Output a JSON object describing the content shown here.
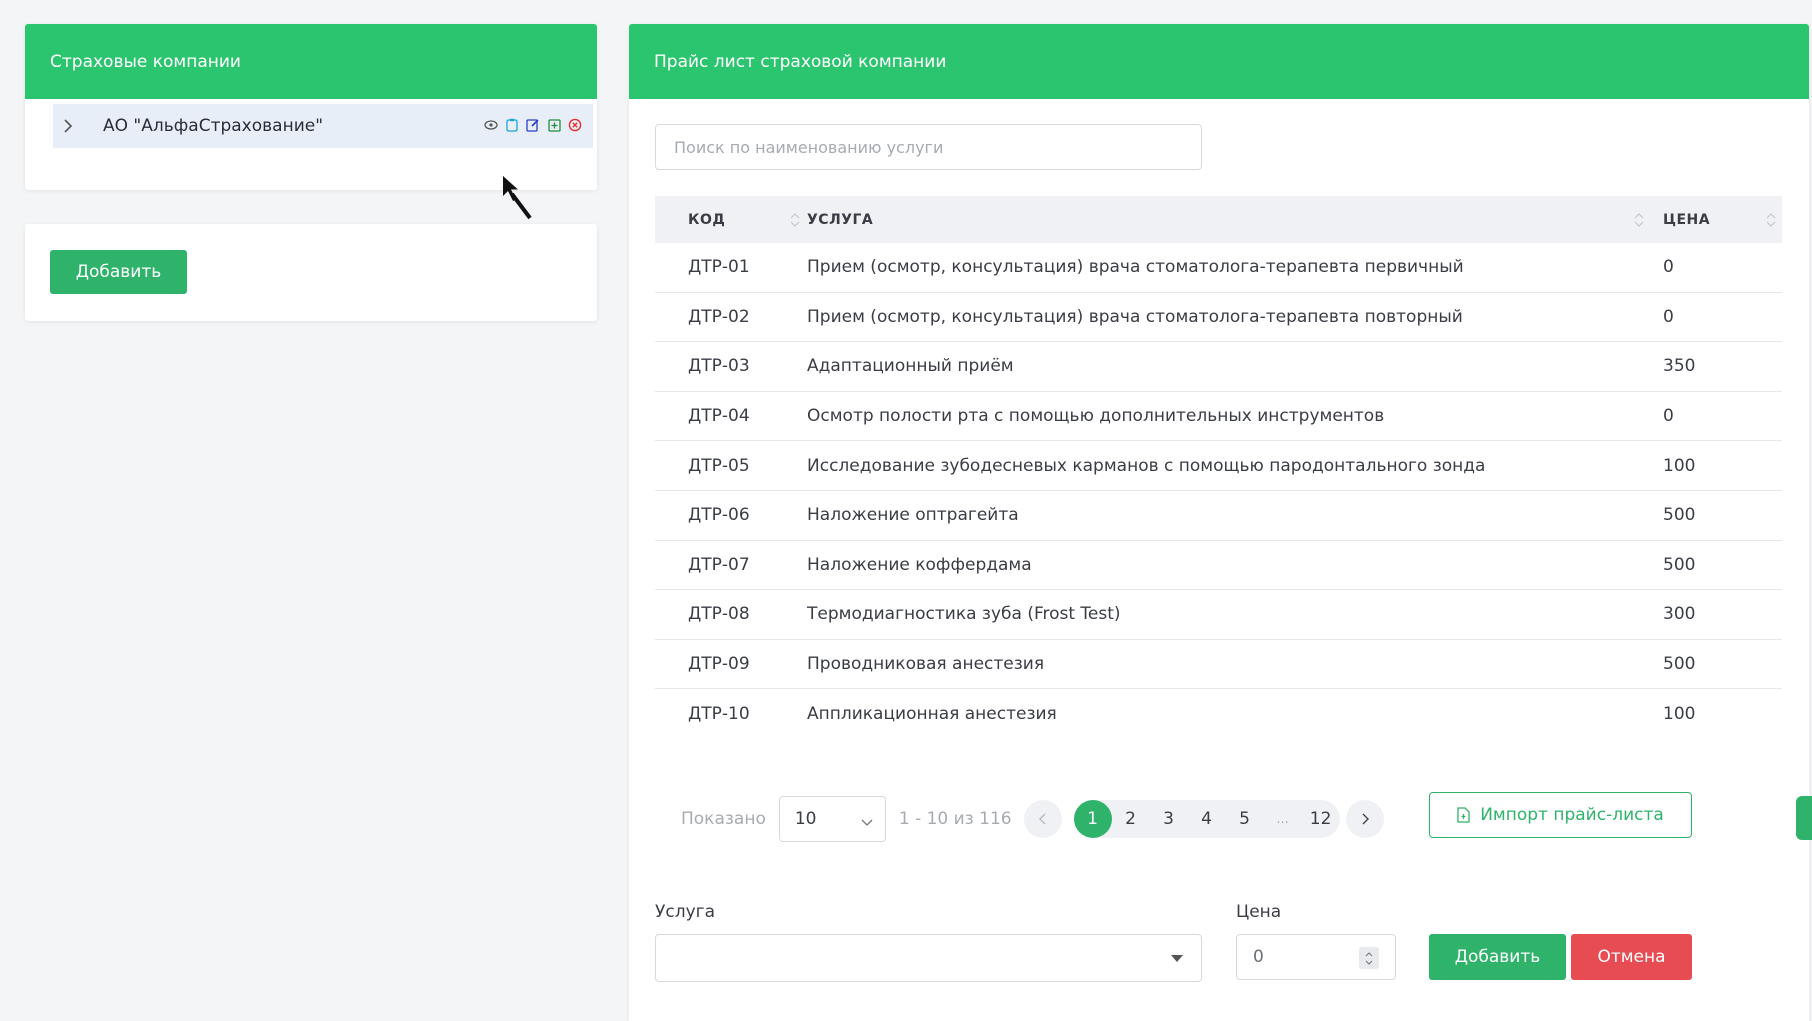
{
  "companies_panel": {
    "title": "Страховые компании",
    "items": [
      {
        "name": "АО \"АльфаСтрахование\""
      }
    ],
    "add_label": "Добавить"
  },
  "price_panel": {
    "title": "Прайс лист страховой компании",
    "search_placeholder": "Поиск по наименованию услуги",
    "columns": {
      "code": "КОД",
      "service": "УСЛУГА",
      "price": "ЦЕНА"
    },
    "rows": [
      {
        "code": "ДТР-01",
        "service": "Прием (осмотр, консультация) врача стоматолога-терапевта первичный",
        "price": "0"
      },
      {
        "code": "ДТР-02",
        "service": "Прием (осмотр, консультация) врача стоматолога-терапевта повторный",
        "price": "0"
      },
      {
        "code": "ДТР-03",
        "service": "Адаптационный приём",
        "price": "350"
      },
      {
        "code": "ДТР-04",
        "service": "Осмотр полости рта с помощью дополнительных инструментов",
        "price": "0"
      },
      {
        "code": "ДТР-05",
        "service": "Исследование зубодесневых карманов с помощью пародонтального зонда",
        "price": "100"
      },
      {
        "code": "ДТР-06",
        "service": "Наложение оптрагейта",
        "price": "500"
      },
      {
        "code": "ДТР-07",
        "service": "Наложение коффердама",
        "price": "500"
      },
      {
        "code": "ДТР-08",
        "service": "Термодиагностика зуба (Frost Test)",
        "price": "300"
      },
      {
        "code": "ДТР-09",
        "service": "Проводниковая анестезия",
        "price": "500"
      },
      {
        "code": "ДТР-10",
        "service": "Аппликационная анестезия",
        "price": "100"
      }
    ],
    "pagination": {
      "shown_label": "Показано",
      "page_size": "10",
      "range": "1 - 10 из 116",
      "pages": [
        "1",
        "2",
        "3",
        "4",
        "5",
        "...",
        "12"
      ],
      "current": "1"
    },
    "import_label": "Импорт прайс-листа",
    "form": {
      "service_label": "Услуга",
      "price_label": "Цена",
      "price_value": "0",
      "add_label": "Добавить",
      "cancel_label": "Отмена"
    }
  },
  "colors": {
    "header_green": "#2cc56f",
    "button_green": "#2fb36b",
    "cancel_red": "#e74c52",
    "selected_row": "#e8eef8"
  }
}
